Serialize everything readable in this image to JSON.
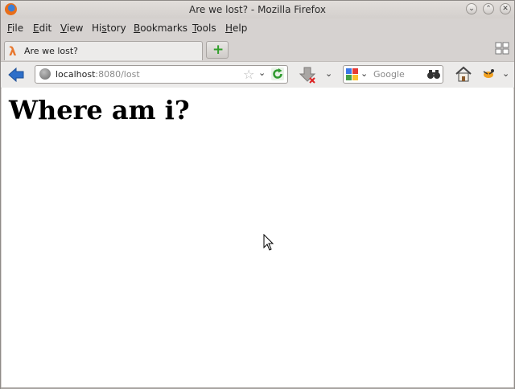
{
  "window": {
    "title": "Are we lost? - Mozilla Firefox",
    "logo_icon": "firefox-logo-icon",
    "buttons": [
      "minimize",
      "maximize",
      "close"
    ]
  },
  "menubar": {
    "items": [
      {
        "label": "File",
        "key": "F"
      },
      {
        "label": "Edit",
        "key": "E"
      },
      {
        "label": "View",
        "key": "V"
      },
      {
        "label": "History",
        "key": "s"
      },
      {
        "label": "Bookmarks",
        "key": "B"
      },
      {
        "label": "Tools",
        "key": "T"
      },
      {
        "label": "Help",
        "key": "H"
      }
    ]
  },
  "tabs": [
    {
      "label": "Are we lost?",
      "icon": "lambda-icon",
      "active": true
    }
  ],
  "navbar": {
    "url_host": "localhost",
    "url_rest": ":8080/lost",
    "search_placeholder": "Google"
  },
  "page": {
    "heading": "Where am i?"
  },
  "colors": {
    "favicon": "#e8772e",
    "newtab_plus": "#33a02c",
    "reload": "#2e9a2e",
    "back_arrow": "#2e6fc9"
  }
}
